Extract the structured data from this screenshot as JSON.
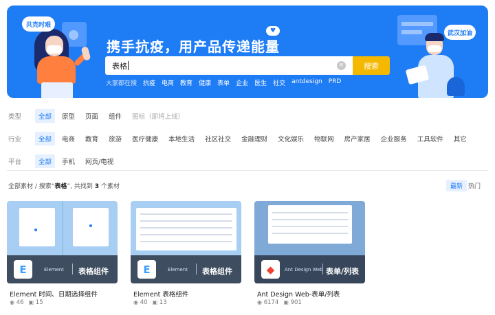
{
  "banner": {
    "title": "携手抗疫，用产品传递能量",
    "badge_left": "共克时艰",
    "badge_right": "武汉加油",
    "heart_icon": "♥",
    "search": {
      "value": "表格",
      "button": "搜索",
      "clear_icon": "×"
    },
    "hot_lead": "大家都在搜",
    "hot_tags": [
      "抗疫",
      "电商",
      "教育",
      "健康",
      "表单",
      "企业",
      "医生",
      "社交",
      "antdesign",
      "PRD"
    ]
  },
  "filters": {
    "type": {
      "label": "类型",
      "options": [
        "全部",
        "原型",
        "页面",
        "组件",
        "图标（即将上线）"
      ]
    },
    "industry": {
      "label": "行业",
      "options": [
        "全部",
        "电商",
        "教育",
        "旅游",
        "医疗健康",
        "本地生活",
        "社区社交",
        "金融理财",
        "文化娱乐",
        "物联网",
        "房产家居",
        "企业服务",
        "工具软件",
        "其它"
      ]
    },
    "platform": {
      "label": "平台",
      "options": [
        "全部",
        "手机",
        "网页/电视"
      ]
    }
  },
  "results": {
    "prefix": "全部素材 / 搜索“",
    "keyword": "表格",
    "middle": "”, 共找到",
    "count": "3",
    "suffix": "个素材",
    "sort_latest": "最新",
    "sort_hot": "热门"
  },
  "cards": [
    {
      "brand": "Element",
      "title": "表格组件",
      "name": "Element 时间、日期选择组件",
      "views": "46",
      "saves": "15",
      "logo_color": "#409eff"
    },
    {
      "brand": "Element",
      "title": "表格组件",
      "name": "Element 表格组件",
      "views": "40",
      "saves": "13",
      "logo_color": "#409eff"
    },
    {
      "brand": "Ant Design Web",
      "title": "表单/列表",
      "name": "Ant Design Web-表单/列表",
      "views": "6174",
      "saves": "901",
      "logo_color": "#f04134"
    }
  ],
  "icons": {
    "views": "eye-icon",
    "saves": "bookmark-icon"
  },
  "colors": {
    "primary": "#1e7cf5",
    "search_button": "#f5b800"
  }
}
